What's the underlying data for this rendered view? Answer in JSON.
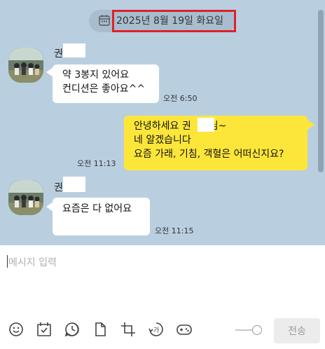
{
  "chat": {
    "date_label": "2025년 8월 19일 화요일",
    "messages": [
      {
        "sender": "권",
        "direction": "in",
        "lines": [
          "약  3봉지 있어요",
          "컨디션은 좋아요^^"
        ],
        "time": "오전 6:50"
      },
      {
        "direction": "out",
        "lines": [
          "안녕하세요 권",
          "님~",
          "네 알겠습니다",
          "요즘 가래, 기침, 객혈은 어떠신지요?"
        ],
        "time": "오전 11:13"
      },
      {
        "sender": "권",
        "direction": "in",
        "lines": [
          "요즘은 다 없어요"
        ],
        "time": "오전 11:15"
      }
    ]
  },
  "composer": {
    "placeholder": "메시지 입력",
    "send_label": "전송",
    "tools": [
      "emoji-icon",
      "calendar-check-icon",
      "clock-icon",
      "file-icon",
      "crop-icon",
      "translate-icon",
      "game-controller-icon"
    ]
  },
  "colors": {
    "background": "#b9cfe0",
    "outgoing_bubble": "#fde63a",
    "incoming_bubble": "#ffffff",
    "highlight_box": "#e0202a"
  }
}
